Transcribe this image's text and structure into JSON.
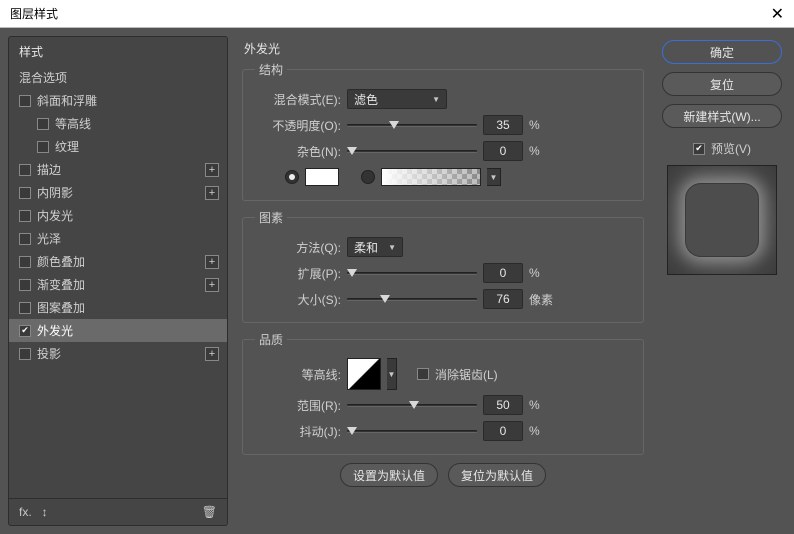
{
  "window": {
    "title": "图层样式",
    "close": "✕"
  },
  "sidebar": {
    "header": "样式",
    "blending": "混合选项",
    "items": [
      {
        "label": "斜面和浮雕",
        "checked": false,
        "add": false,
        "indent": 0
      },
      {
        "label": "等高线",
        "checked": false,
        "add": false,
        "indent": 1
      },
      {
        "label": "纹理",
        "checked": false,
        "add": false,
        "indent": 1
      },
      {
        "label": "描边",
        "checked": false,
        "add": true,
        "indent": 0
      },
      {
        "label": "内阴影",
        "checked": false,
        "add": true,
        "indent": 0
      },
      {
        "label": "内发光",
        "checked": false,
        "add": false,
        "indent": 0
      },
      {
        "label": "光泽",
        "checked": false,
        "add": false,
        "indent": 0
      },
      {
        "label": "颜色叠加",
        "checked": false,
        "add": true,
        "indent": 0
      },
      {
        "label": "渐变叠加",
        "checked": false,
        "add": true,
        "indent": 0
      },
      {
        "label": "图案叠加",
        "checked": false,
        "add": false,
        "indent": 0
      },
      {
        "label": "外发光",
        "checked": true,
        "add": false,
        "indent": 0,
        "selected": true
      },
      {
        "label": "投影",
        "checked": false,
        "add": true,
        "indent": 0
      }
    ],
    "footer": {
      "fx": "fx.",
      "trash": "🗑"
    }
  },
  "panel": {
    "title": "外发光",
    "structure": {
      "legend": "结构",
      "blendModeLabel": "混合模式(E):",
      "blendModeValue": "滤色",
      "opacityLabel": "不透明度(O):",
      "opacityValue": "35",
      "opacityUnit": "%",
      "noiseLabel": "杂色(N):",
      "noiseValue": "0",
      "noiseUnit": "%"
    },
    "elements": {
      "legend": "图素",
      "techniqueLabel": "方法(Q):",
      "techniqueValue": "柔和",
      "spreadLabel": "扩展(P):",
      "spreadValue": "0",
      "spreadUnit": "%",
      "sizeLabel": "大小(S):",
      "sizeValue": "76",
      "sizeUnit": "像素"
    },
    "quality": {
      "legend": "品质",
      "contourLabel": "等高线:",
      "antiAliasLabel": "消除锯齿(L)",
      "rangeLabel": "范围(R):",
      "rangeValue": "50",
      "rangeUnit": "%",
      "jitterLabel": "抖动(J):",
      "jitterValue": "0",
      "jitterUnit": "%"
    },
    "defaults": {
      "setDefault": "设置为默认值",
      "resetDefault": "复位为默认值"
    }
  },
  "right": {
    "ok": "确定",
    "cancel": "复位",
    "newStyle": "新建样式(W)...",
    "previewLabel": "预览(V)"
  }
}
